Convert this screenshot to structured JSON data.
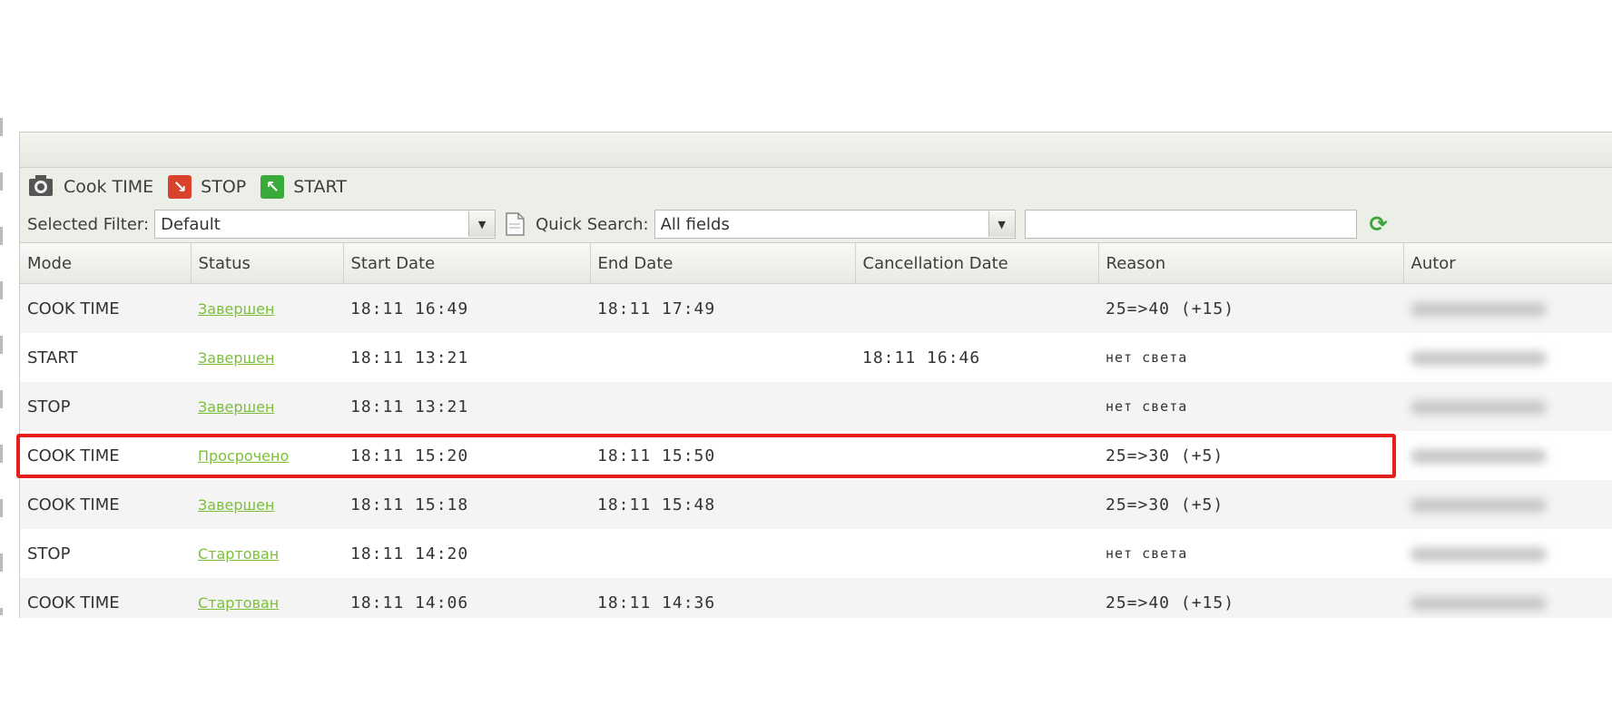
{
  "toolbar": {
    "cook_time_label": "Cook TIME",
    "stop_label": "STOP",
    "start_label": "START"
  },
  "filter": {
    "selected_filter_label": "Selected Filter:",
    "selected_filter_value": "Default",
    "quick_search_label": "Quick Search:",
    "quick_search_field": "All fields",
    "quick_search_value": ""
  },
  "table": {
    "columns": [
      "Mode",
      "Status",
      "Start Date",
      "End Date",
      "Cancellation Date",
      "Reason",
      "Autor"
    ],
    "rows": [
      {
        "mode": "COOK TIME",
        "status": "Завершен",
        "start": "18:11 16:49",
        "end": "18:11 17:49",
        "cancel": "",
        "reason": "25=>40 (+15)"
      },
      {
        "mode": "START",
        "status": "Завершен",
        "start": "18:11 13:21",
        "end": "",
        "cancel": "18:11 16:46",
        "reason": "нет света"
      },
      {
        "mode": "STOP",
        "status": "Завершен",
        "start": "18:11 13:21",
        "end": "",
        "cancel": "",
        "reason": "нет света"
      },
      {
        "mode": "COOK TIME",
        "status": "Просрочено",
        "start": "18:11 15:20",
        "end": "18:11 15:50",
        "cancel": "",
        "reason": "25=>30 (+5)"
      },
      {
        "mode": "COOK TIME",
        "status": "Завершен",
        "start": "18:11 15:18",
        "end": "18:11 15:48",
        "cancel": "",
        "reason": "25=>30 (+5)"
      },
      {
        "mode": "STOP",
        "status": "Стартован",
        "start": "18:11 14:20",
        "end": "",
        "cancel": "",
        "reason": "нет света"
      },
      {
        "mode": "COOK TIME",
        "status": "Стартован",
        "start": "18:11 14:06",
        "end": "18:11 14:36",
        "cancel": "",
        "reason": "25=>40 (+15)"
      }
    ]
  },
  "colors": {
    "status_link": "#7bbf3a",
    "highlight_border": "#e3201d",
    "stop_icon": "#d9432b",
    "start_icon": "#3aab3a"
  }
}
